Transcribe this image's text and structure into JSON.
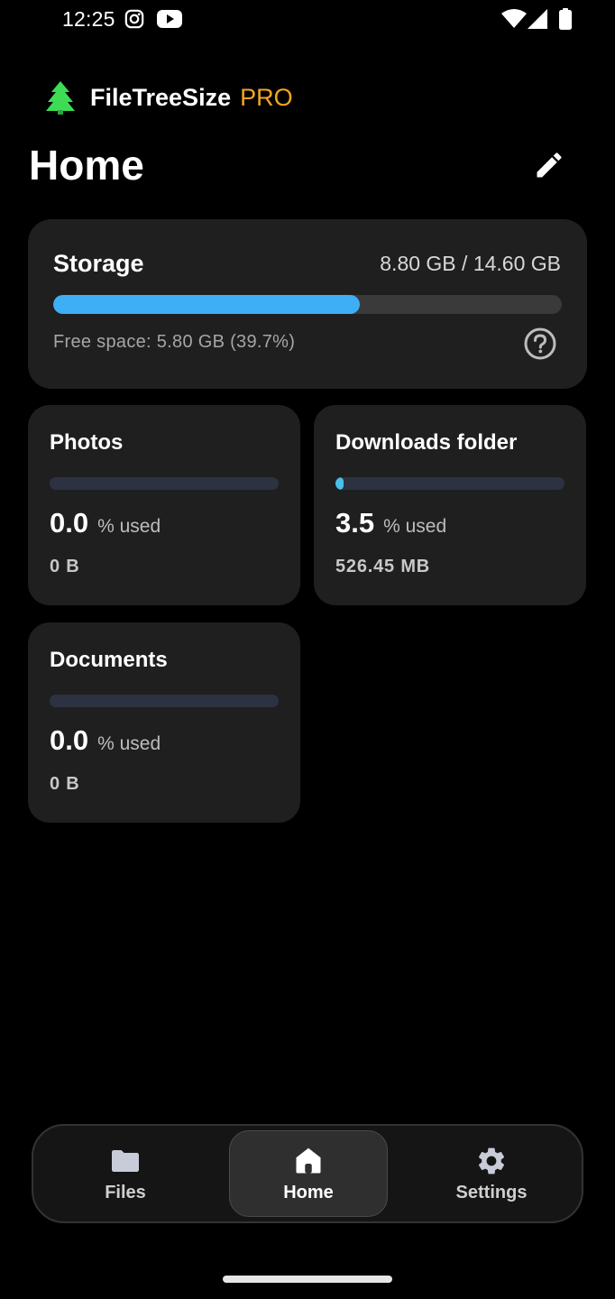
{
  "status_bar": {
    "time": "12:25",
    "icons": [
      "instagram-icon",
      "youtube-icon",
      "wifi-icon",
      "signal-icon",
      "battery-icon"
    ]
  },
  "app": {
    "name": "FileTreeSize",
    "badge": "PRO",
    "badge_color": "#f5a623",
    "logo": "tree-icon"
  },
  "page": {
    "title": "Home",
    "edit_icon": "pencil-icon"
  },
  "storage": {
    "title": "Storage",
    "usage": "8.80 GB / 14.60 GB",
    "used_fraction": 0.603,
    "bar_color": "#3eaff5",
    "free_text": "Free space: 5.80 GB (39.7%)",
    "help_icon": "help-circle-icon"
  },
  "folders": [
    {
      "name": "Photos",
      "percent": "0.0",
      "unit": "% used",
      "size": "0 B",
      "fraction": 0.0
    },
    {
      "name": "Downloads folder",
      "percent": "3.5",
      "unit": "% used",
      "size": "526.45 MB",
      "fraction": 0.035
    },
    {
      "name": "Documents",
      "percent": "0.0",
      "unit": "% used",
      "size": "0 B",
      "fraction": 0.0
    }
  ],
  "nav": {
    "files": {
      "label": "Files",
      "icon": "folder-icon"
    },
    "home": {
      "label": "Home",
      "icon": "home-icon",
      "active": true
    },
    "settings": {
      "label": "Settings",
      "icon": "gear-icon"
    }
  }
}
